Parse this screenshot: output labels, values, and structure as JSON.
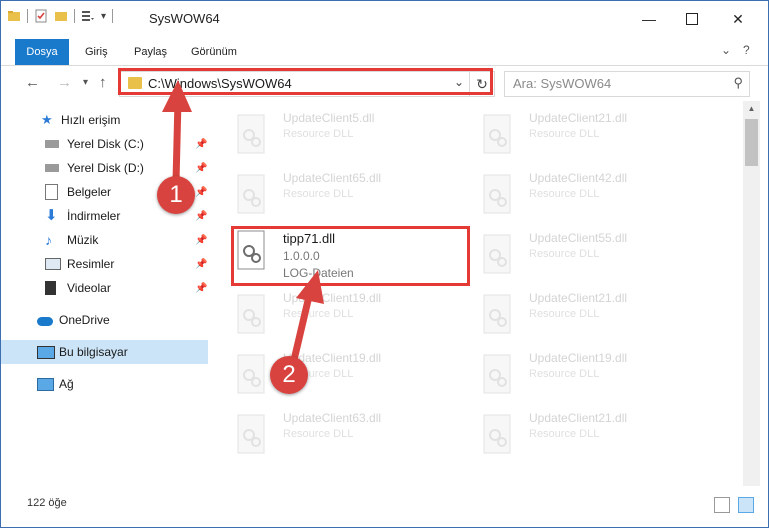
{
  "window": {
    "title": "SysWOW64"
  },
  "ribbon": {
    "tabs": [
      "Dosya",
      "Giriş",
      "Paylaş",
      "Görünüm"
    ]
  },
  "address": {
    "path": "C:\\Windows\\SysWOW64",
    "search_placeholder": "Ara: SysWOW64"
  },
  "nav": {
    "quick_access": "Hızlı erişim",
    "items": [
      "Yerel Disk (C:)",
      "Yerel Disk (D:)",
      "Belgeler",
      "İndirmeler",
      "Müzik",
      "Resimler",
      "Videolar"
    ],
    "onedrive": "OneDrive",
    "this_pc": "Bu bilgisayar",
    "network": "Ağ"
  },
  "files": [
    {
      "name": "UpdateClient5.dll",
      "type": "Resource DLL"
    },
    {
      "name": "UpdateClient21.dll",
      "type": "Resource DLL"
    },
    {
      "name": "UpdateClient65.dll",
      "type": "Resource DLL"
    },
    {
      "name": "UpdateClient42.dll",
      "type": "Resource DLL"
    },
    {
      "name": "tipp71.dll",
      "version": "1.0.0.0",
      "type": "LOG-Dateien"
    },
    {
      "name": "UpdateClient55.dll",
      "type": "Resource DLL"
    },
    {
      "name": "UpdateClient19.dll",
      "type": "Resource DLL"
    },
    {
      "name": "UpdateClient21.dll",
      "type": "Resource DLL"
    },
    {
      "name": "UpdateClient19.dll",
      "type": "Resource DLL"
    },
    {
      "name": "UpdateClient19.dll",
      "type": "Resource DLL"
    },
    {
      "name": "UpdateClient63.dll",
      "type": "Resource DLL"
    },
    {
      "name": "UpdateClient21.dll",
      "type": "Resource DLL"
    }
  ],
  "status": {
    "count": "122 öğe"
  },
  "badges": {
    "one": "1",
    "two": "2"
  },
  "colors": {
    "accent": "#1979ca",
    "highlight": "#e53935",
    "selection": "#cce4f7"
  }
}
